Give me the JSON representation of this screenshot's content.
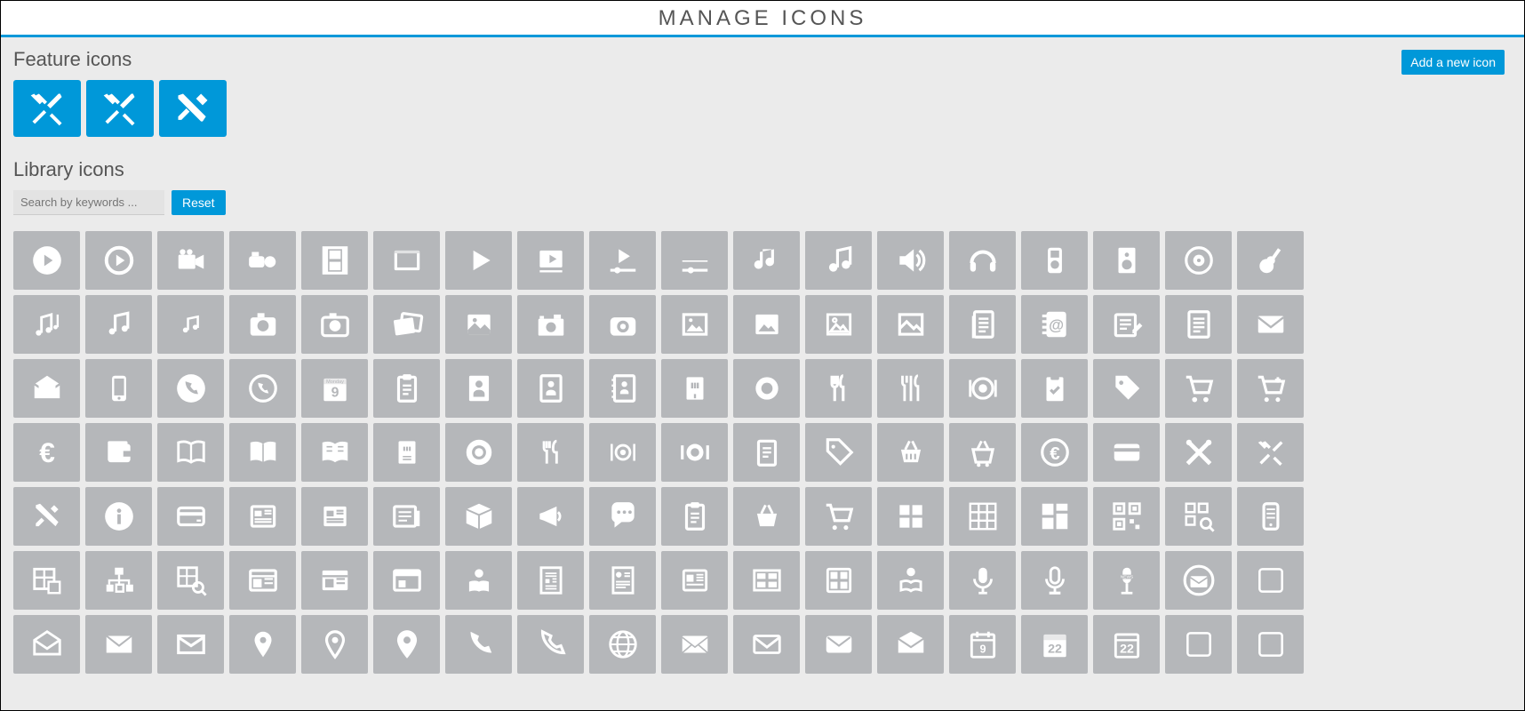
{
  "header": {
    "title": "MANAGE ICONS"
  },
  "add_button": {
    "label": "Add a new icon"
  },
  "sections": {
    "feature": {
      "title": "Feature icons"
    },
    "library": {
      "title": "Library icons"
    }
  },
  "search": {
    "placeholder": "Search by keywords ...",
    "value": ""
  },
  "reset_button": {
    "label": "Reset"
  },
  "feature_icons": [
    "crossed-utensils",
    "crossed-utensils",
    "crossed-pen-ruler"
  ],
  "library_icons": [
    "play-circle",
    "play-ring",
    "video-camera",
    "handycam",
    "film-strip",
    "film-frames",
    "play-triangle",
    "play-screen",
    "play-slider-alt",
    "music-slider",
    "music-note",
    "music-note-alt",
    "volume",
    "headphones",
    "ipod",
    "speaker",
    "speaker-round",
    "guitar",
    "music-notes-multi",
    "music-notes",
    "music-notes-small",
    "camera",
    "camera-alt",
    "photos",
    "picture",
    "camera-slr",
    "camera-front",
    "image-frame",
    "image",
    "image-outline",
    "image-alt",
    "document-list",
    "address-book",
    "edit-note",
    "doc-lines",
    "envelope",
    "envelope-open",
    "smartphone",
    "phone-circle",
    "phone-ring",
    "calendar-monday-9",
    "clipboard",
    "contact-card",
    "id-card",
    "notebook",
    "restaurant",
    "plate",
    "cutlery",
    "cutlery-alt",
    "plate-alt",
    "clipboard-check",
    "price-tag",
    "shopping-cart",
    "cart-add",
    "euro",
    "wallet",
    "book-open",
    "book",
    "book-solid",
    "menu-card",
    "plate-fill",
    "cutlery-round",
    "place-setting",
    "dinner",
    "notepad",
    "price-tag-alt",
    "basket",
    "basket-cart",
    "euro-alt",
    "card",
    "cross-tools",
    "cross-utensils",
    "cross-draft",
    "info-circle",
    "credit-card",
    "news",
    "newspaper",
    "news-alt",
    "package",
    "megaphone",
    "speech",
    "clipboard-lines",
    "basket-alt",
    "cart-alt",
    "grid-2x2",
    "grid-3x3",
    "grid-layout",
    "qr-code",
    "qr-scan",
    "mobile",
    "blueprint",
    "sitemap",
    "map-search",
    "browser",
    "browser-alt",
    "window",
    "reader",
    "layout-doc",
    "resume",
    "article",
    "gallery",
    "album",
    "reading",
    "mic",
    "mic-alt",
    "mic-news",
    "mail-circle",
    "placeholder",
    "mail-open",
    "mail-flat",
    "mail-a",
    "pin",
    "pin-alt",
    "pin-fill",
    "phone-fill",
    "phone-out",
    "globe",
    "mail-b",
    "mail-c",
    "mail-d",
    "mail-e",
    "calendar-alt",
    "calendar-22",
    "calendar-22-alt",
    "placeholder",
    "placeholder"
  ],
  "calendar_labels": {
    "monday": "Monday",
    "nine": "9",
    "twentytwo": "22"
  }
}
